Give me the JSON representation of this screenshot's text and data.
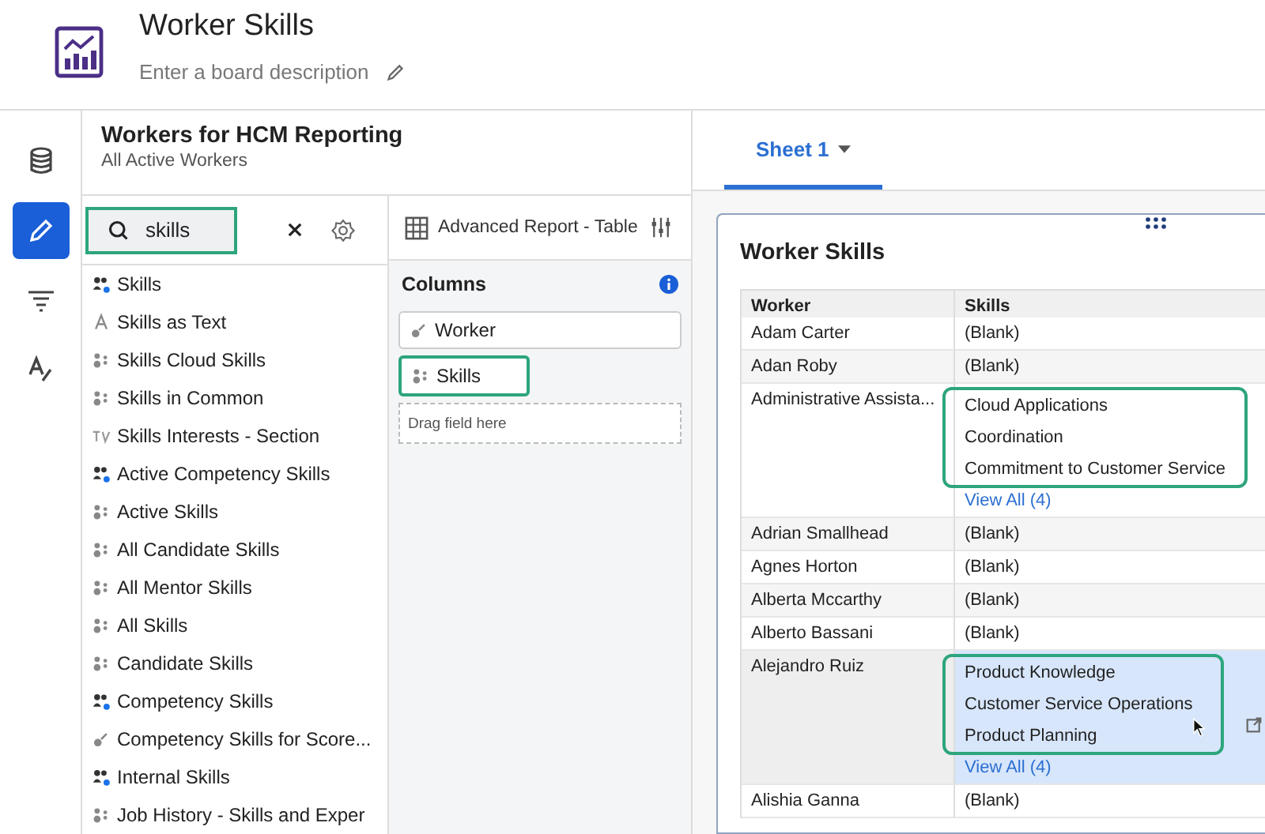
{
  "board": {
    "title": "Worker Skills",
    "description_placeholder": "Enter a board description"
  },
  "rail": [
    {
      "kind": "data",
      "selected": false
    },
    {
      "kind": "edit",
      "selected": true
    },
    {
      "kind": "filter",
      "selected": false
    },
    {
      "kind": "format",
      "selected": false
    }
  ],
  "source": {
    "title": "Workers for HCM Reporting",
    "subtitle": "All Active Workers"
  },
  "search": {
    "value": "skills",
    "highlighted": true
  },
  "fields": [
    {
      "label": "Skills",
      "kind": "multi_primary"
    },
    {
      "label": "Skills as Text",
      "kind": "text"
    },
    {
      "label": "Skills Cloud Skills",
      "kind": "multi"
    },
    {
      "label": "Skills in Common",
      "kind": "multi"
    },
    {
      "label": "Skills Interests - Section",
      "kind": "section"
    },
    {
      "label": "Active Competency Skills",
      "kind": "multi_primary"
    },
    {
      "label": "Active Skills",
      "kind": "multi"
    },
    {
      "label": "All Candidate Skills",
      "kind": "multi"
    },
    {
      "label": "All Mentor Skills",
      "kind": "multi"
    },
    {
      "label": "All Skills",
      "kind": "multi"
    },
    {
      "label": "Candidate Skills",
      "kind": "multi"
    },
    {
      "label": "Competency Skills",
      "kind": "multi_primary"
    },
    {
      "label": "Competency Skills for Score...",
      "kind": "single"
    },
    {
      "label": "Internal Skills",
      "kind": "multi_primary"
    },
    {
      "label": "Job History - Skills and Exper",
      "kind": "multi"
    }
  ],
  "report_type": "Advanced Report - Table",
  "columns": {
    "title": "Columns",
    "items": [
      {
        "label": "Worker",
        "kind": "single",
        "highlighted": false
      },
      {
        "label": "Skills",
        "kind": "multi",
        "highlighted": true
      }
    ],
    "drop_hint": "Drag field here"
  },
  "sheet_tab": {
    "label": "Sheet 1",
    "selected": true
  },
  "table": {
    "title": "Worker Skills",
    "columns": [
      "Worker",
      "Skills"
    ],
    "rows": [
      {
        "worker": "Adam Carter",
        "skills": [
          "(Blank)"
        ],
        "selected": false,
        "highlighted": false
      },
      {
        "worker": "Adan Roby",
        "skills": [
          "(Blank)"
        ],
        "selected": false,
        "highlighted": false
      },
      {
        "worker": "Administrative Assista...",
        "skills": [
          "Cloud Applications",
          "Coordination",
          "Commitment to Customer Service"
        ],
        "view_all": "View All (4)",
        "selected": false,
        "highlighted": true
      },
      {
        "worker": "Adrian Smallhead",
        "skills": [
          "(Blank)"
        ],
        "selected": false,
        "highlighted": false
      },
      {
        "worker": "Agnes Horton",
        "skills": [
          "(Blank)"
        ],
        "selected": false,
        "highlighted": false
      },
      {
        "worker": "Alberta Mccarthy",
        "skills": [
          "(Blank)"
        ],
        "selected": false,
        "highlighted": false
      },
      {
        "worker": "Alberto Bassani",
        "skills": [
          "(Blank)"
        ],
        "selected": false,
        "highlighted": false
      },
      {
        "worker": "Alejandro Ruiz",
        "skills": [
          "Product Knowledge",
          "Customer Service Operations",
          "Product Planning"
        ],
        "view_all": "View All (4)",
        "selected": true,
        "highlighted": true
      },
      {
        "worker": "Alishia Ganna",
        "skills": [
          "(Blank)"
        ],
        "selected": false,
        "highlighted": false
      }
    ]
  }
}
